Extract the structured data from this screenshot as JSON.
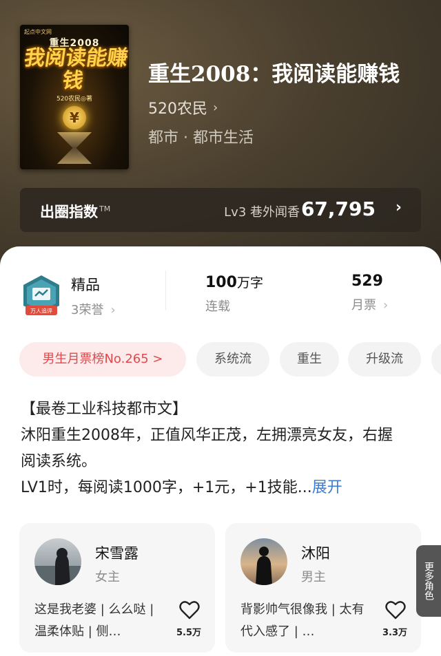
{
  "book": {
    "cover": {
      "publisher_mark": "起点中文网",
      "title_line1": "重生2008",
      "title_line2": "我阅读能赚钱",
      "author": "520农民◎著",
      "coin_symbol": "¥"
    },
    "title": "重生2008：我阅读能赚钱",
    "author": "520农民",
    "genre": "都市 · 都市生活"
  },
  "index": {
    "label": "出圈指数",
    "trademark": "TM",
    "level": "Lv3 巷外闻香",
    "value": "67,795",
    "arrow": "›"
  },
  "stats": {
    "honor": {
      "badge_text": "万人追评",
      "title": "精品",
      "subtitle": "3荣誉"
    },
    "words": {
      "number": "100",
      "unit": "万字",
      "status": "连载"
    },
    "tickets": {
      "number": "529",
      "label": "月票"
    }
  },
  "tags": [
    "男生月票榜No.265 >",
    "系统流",
    "重生",
    "升级流"
  ],
  "synopsis": {
    "line1": "【最卷工业科技都市文】",
    "line2": "沐阳重生2008年，正值风华正茂，左拥漂亮女友，右握阅读系统。",
    "line3": "LV1时，每阅读1000字，+1元，+1技能...",
    "more": "展开"
  },
  "characters": [
    {
      "name": "宋雪露",
      "role": "女主",
      "desc": "这是我老婆 | 么么哒 | 温柔体贴 | 侧…",
      "likes": "5.5万"
    },
    {
      "name": "沐阳",
      "role": "男主",
      "desc": "背影帅气很像我 | 太有代入感了 | …",
      "likes": "3.3万"
    }
  ],
  "more_roles": "更多角色",
  "icons": {
    "author_chevron": "chevron-right-icon",
    "like": "heart-icon"
  },
  "colors": {
    "accent_red": "#e2484b",
    "link_blue": "#3a7bd5"
  }
}
